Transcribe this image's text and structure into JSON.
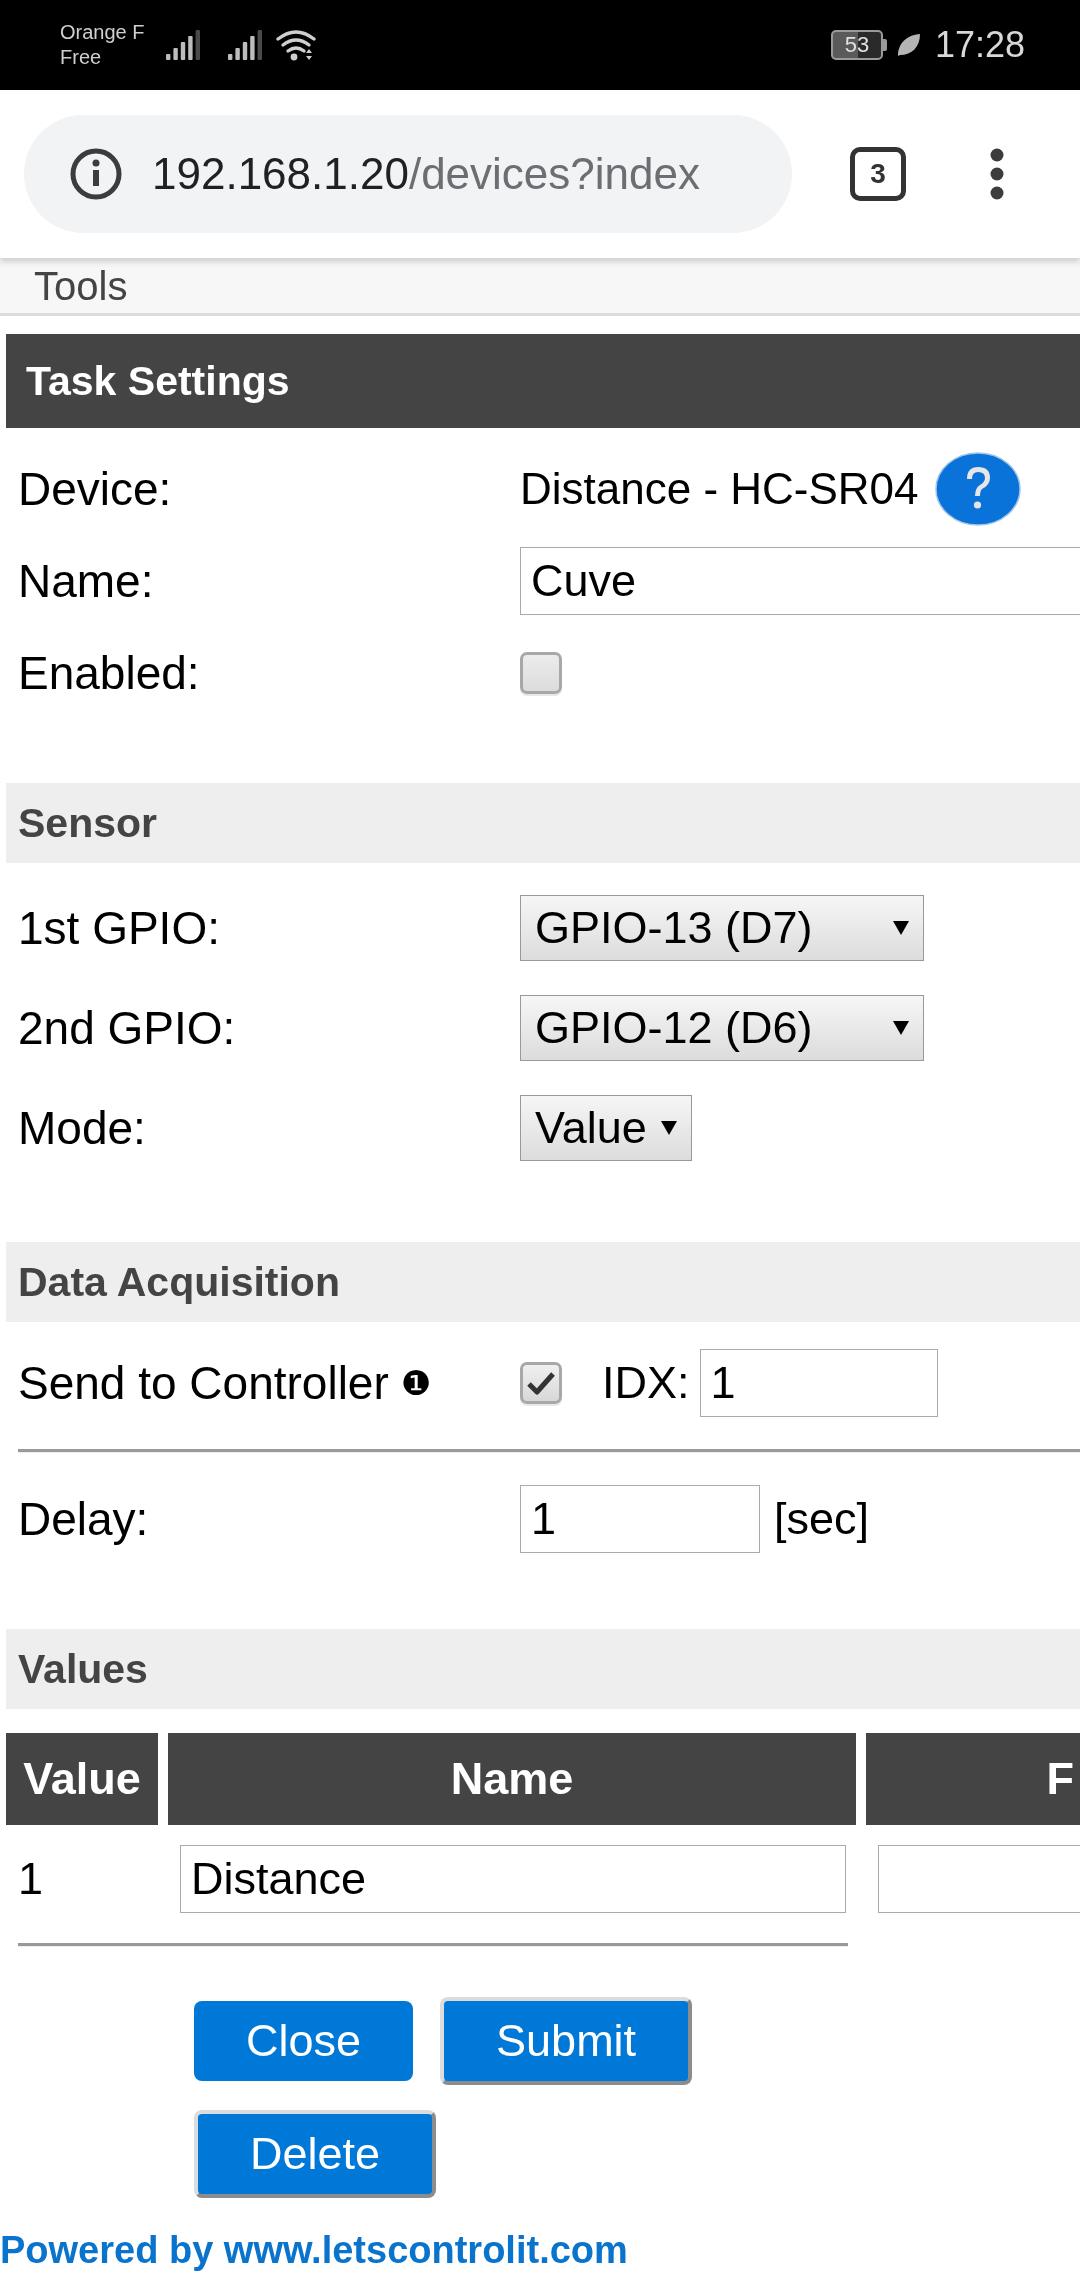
{
  "status_bar": {
    "carrier": "Orange F",
    "carrier_2": "Free",
    "battery": "53",
    "time": "17:28"
  },
  "browser": {
    "url_host": "192.168.1.20",
    "url_path": "/devices?index",
    "tab_count": "3"
  },
  "nav": {
    "label": "Tools"
  },
  "sections": [
    {
      "title": "Task Settings",
      "kind": "main",
      "rows": [
        {
          "kind": "text",
          "label": "Device:",
          "value": "Distance - HC-SR04",
          "help": true
        },
        {
          "kind": "input",
          "label": "Name:",
          "value": "Cuve"
        },
        {
          "kind": "checkbox",
          "label": "Enabled:",
          "checked": false
        }
      ]
    },
    {
      "title": "Sensor",
      "kind": "sub",
      "rows": [
        {
          "kind": "select",
          "label": "1st GPIO:",
          "value": "GPIO-13 (D7)"
        },
        {
          "kind": "select",
          "label": "2nd GPIO:",
          "value": "GPIO-12 (D6)"
        },
        {
          "kind": "select",
          "label": "Mode:",
          "value": "Value"
        }
      ]
    },
    {
      "title": "Data Acquisition",
      "kind": "sub",
      "rows": [
        {
          "kind": "checkbox_idx",
          "label": "Send to Controller",
          "note": "❶",
          "checked": true,
          "idx_label": "IDX:",
          "idx_value": "1"
        },
        {
          "kind": "divider"
        },
        {
          "kind": "input_unit",
          "label": "Delay:",
          "value": "1",
          "unit": "[sec]"
        }
      ]
    }
  ],
  "values": {
    "title": "Values",
    "columns": [
      "Value",
      "Name",
      "F"
    ],
    "rows": [
      {
        "value": "1",
        "name": "Distance"
      }
    ]
  },
  "buttons": [
    {
      "label": "Close",
      "kind": "link"
    },
    {
      "label": "Submit",
      "kind": "submit"
    },
    {
      "label": "Delete",
      "kind": "submit"
    }
  ],
  "footer": {
    "text": "Powered by",
    "link": "www.letscontrolit.com"
  }
}
